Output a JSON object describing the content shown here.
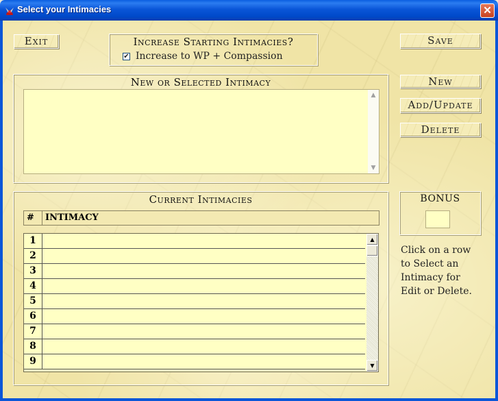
{
  "window": {
    "title": "Select your Intimacies",
    "close_glyph": "✕"
  },
  "buttons": {
    "exit": "Exit",
    "save": "Save",
    "new": "New",
    "add_update": "Add/Update",
    "delete": "Delete"
  },
  "increase_group": {
    "title": "Increase Starting Intimacies?",
    "checkbox_label": "Increase to WP + Compassion",
    "checked": true
  },
  "selected_group": {
    "title": "New or Selected Intimacy",
    "text": ""
  },
  "current_group": {
    "title": "Current Intimacies",
    "columns": [
      "#",
      "INTIMACY"
    ],
    "rows": [
      {
        "num": "1",
        "intimacy": ""
      },
      {
        "num": "2",
        "intimacy": ""
      },
      {
        "num": "3",
        "intimacy": ""
      },
      {
        "num": "4",
        "intimacy": ""
      },
      {
        "num": "5",
        "intimacy": ""
      },
      {
        "num": "6",
        "intimacy": ""
      },
      {
        "num": "7",
        "intimacy": ""
      },
      {
        "num": "8",
        "intimacy": ""
      },
      {
        "num": "9",
        "intimacy": ""
      }
    ]
  },
  "bonus": {
    "title": "BONUS",
    "value": ""
  },
  "help_text": [
    "Click on a row",
    "to Select an",
    "Intimacy for",
    "Edit or Delete."
  ],
  "colors": {
    "title_bar": "#0a56d8",
    "parchment": "#f0e4a6",
    "field": "#ffffc4"
  }
}
